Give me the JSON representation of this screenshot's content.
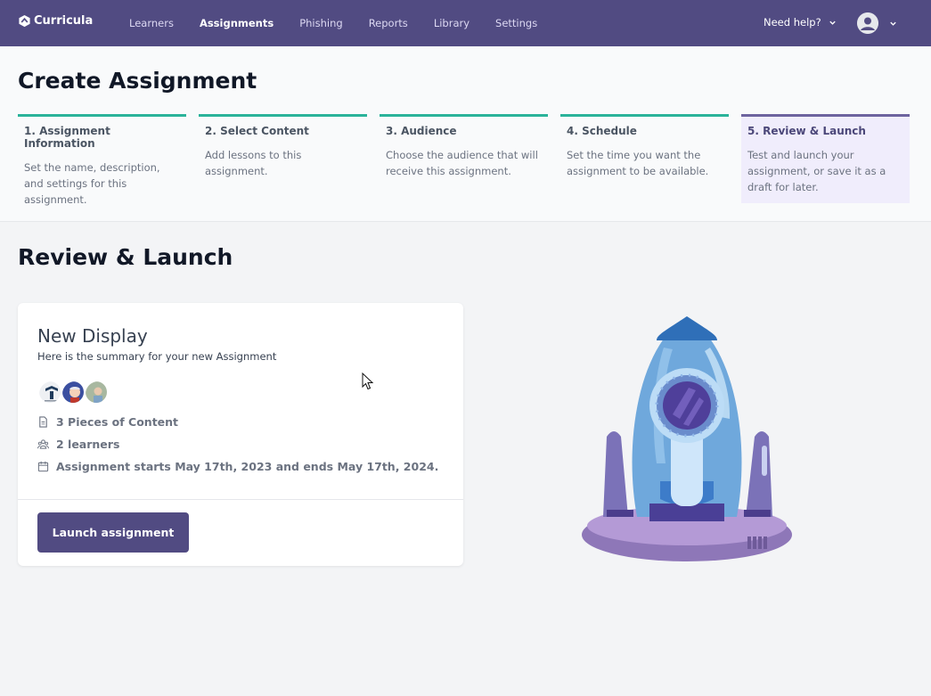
{
  "brand": {
    "name": "Curricula"
  },
  "nav": {
    "items": [
      {
        "label": "Learners",
        "active": false
      },
      {
        "label": "Assignments",
        "active": true
      },
      {
        "label": "Phishing",
        "active": false
      },
      {
        "label": "Reports",
        "active": false
      },
      {
        "label": "Library",
        "active": false
      },
      {
        "label": "Settings",
        "active": false
      }
    ],
    "help_label": "Need help?"
  },
  "page": {
    "title": "Create Assignment"
  },
  "steps": [
    {
      "title": "1. Assignment Information",
      "desc": "Set the name, description, and settings for this assignment."
    },
    {
      "title": "2. Select Content",
      "desc": "Add lessons to this assignment."
    },
    {
      "title": "3. Audience",
      "desc": "Choose the audience that will receive this assignment."
    },
    {
      "title": "4. Schedule",
      "desc": "Set the time you want the assignment to be available."
    },
    {
      "title": "5. Review & Launch",
      "desc": "Test and launch your assignment, or save it as a draft for later."
    }
  ],
  "review": {
    "section_title": "Review & Launch",
    "assignment_name": "New Display",
    "summary_text": "Here is the summary for your new Assignment",
    "content_count": "3 Pieces of Content",
    "learners_count": "2 learners",
    "schedule_text": "Assignment starts May 17th, 2023 and ends May 17th, 2024.",
    "launch_label": "Launch assignment"
  },
  "colors": {
    "nav_bg": "#514b82",
    "step_done": "#2bb39a",
    "step_current": "#6e649f",
    "button": "#514b82"
  }
}
